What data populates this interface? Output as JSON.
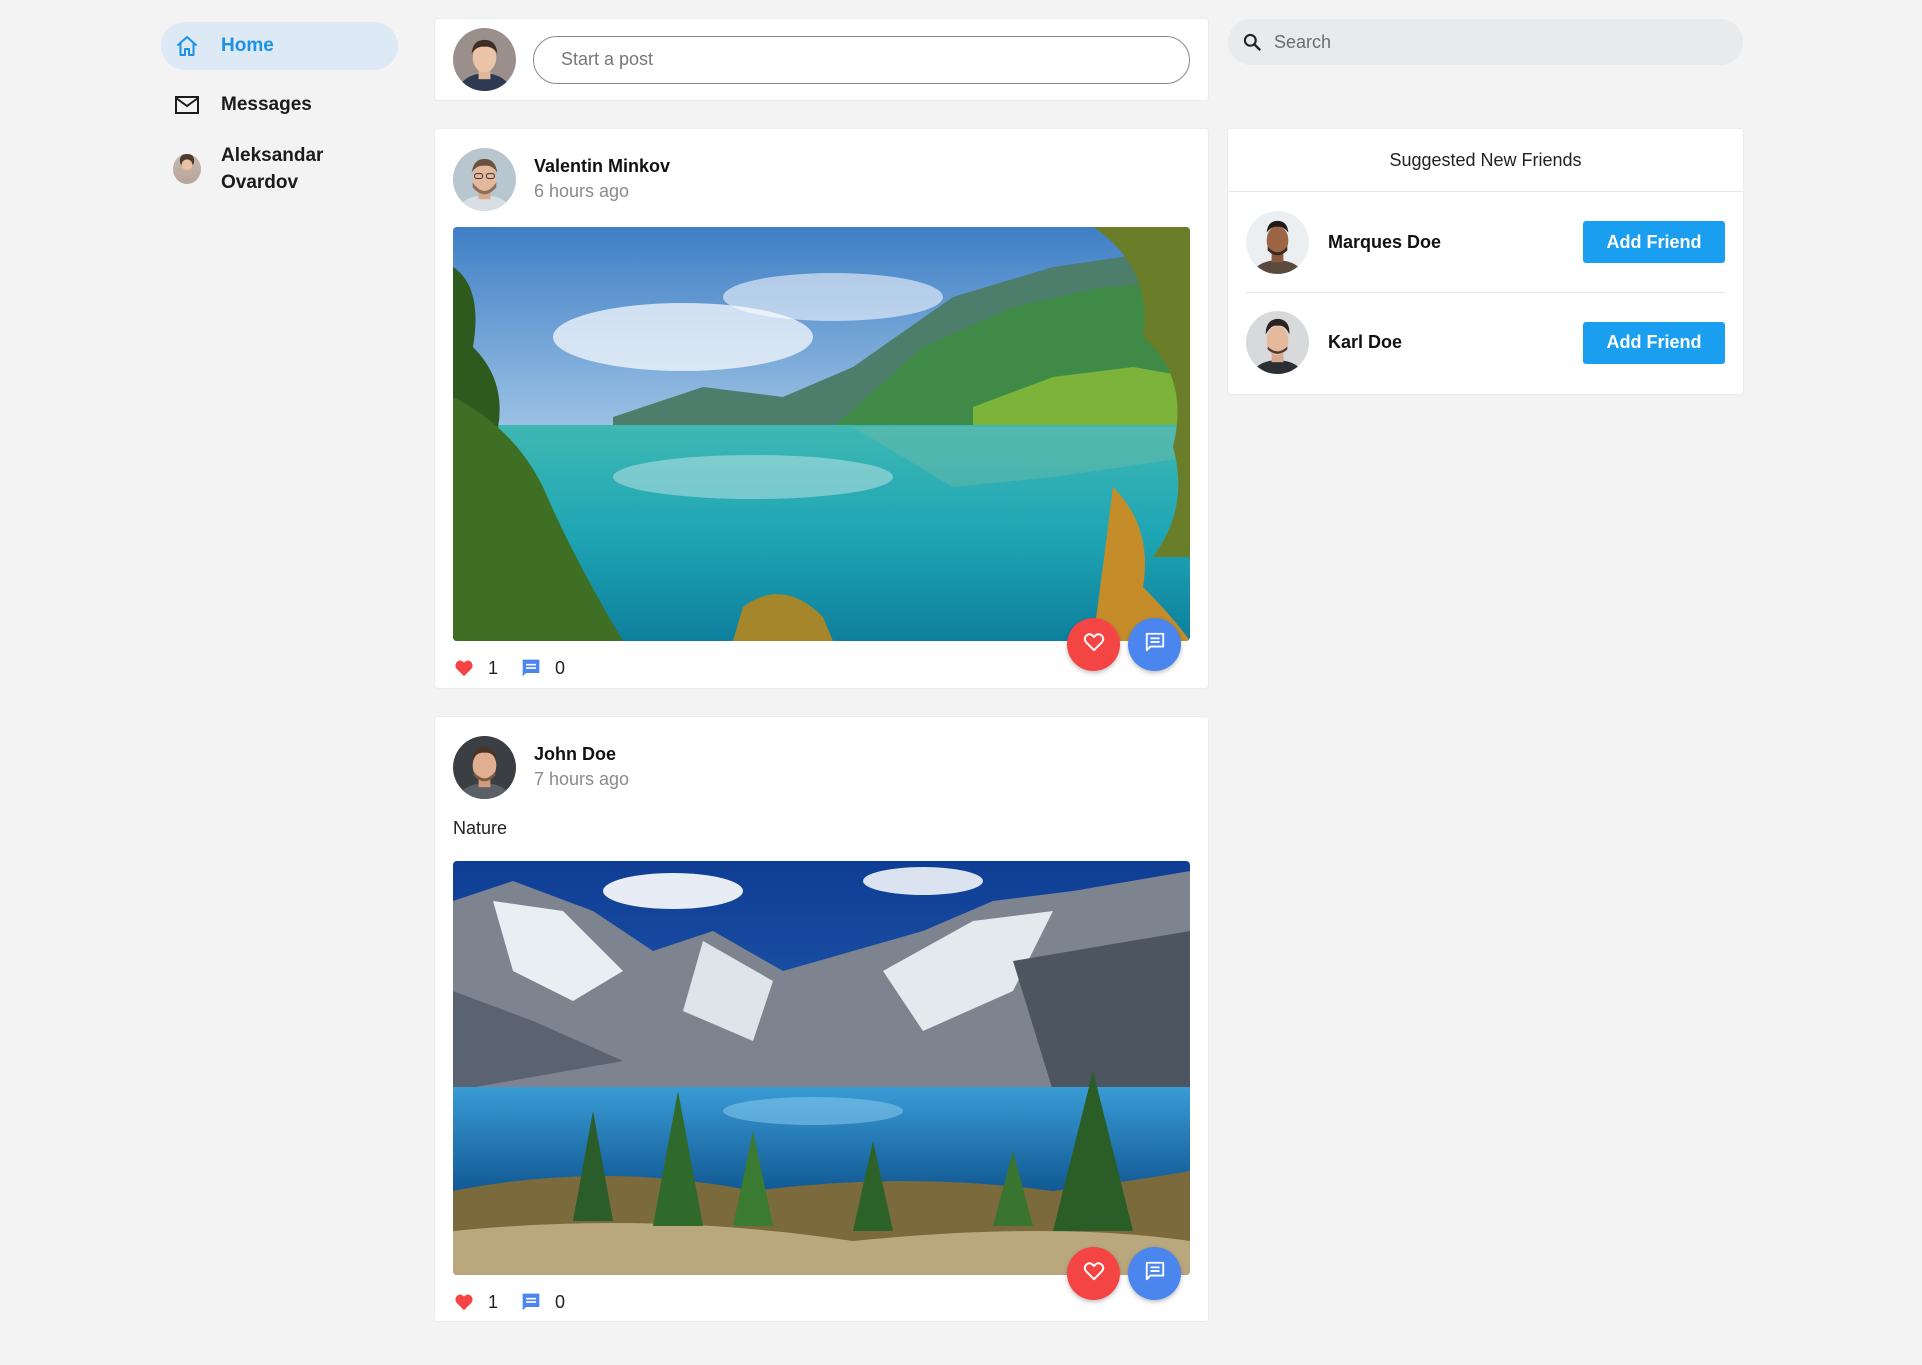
{
  "sidebar": {
    "items": [
      {
        "label": "Home",
        "icon": "home-icon",
        "active": true
      },
      {
        "label": "Messages",
        "icon": "mail-icon",
        "active": false
      },
      {
        "label": "Aleksandar Ovardov",
        "icon": "avatar",
        "active": false
      }
    ]
  },
  "composer": {
    "placeholder": "Start a post"
  },
  "search": {
    "placeholder": "Search"
  },
  "feed": {
    "posts": [
      {
        "author": "Valentin Minkov",
        "time": "6 hours ago",
        "text": "",
        "likes": "1",
        "comments": "0",
        "image": "lake-valley-image"
      },
      {
        "author": "John Doe",
        "time": "7 hours ago",
        "text": "Nature",
        "likes": "1",
        "comments": "0",
        "image": "mountain-lake-image"
      }
    ]
  },
  "suggestions": {
    "title": "Suggested New Friends",
    "friends": [
      {
        "name": "Marques Doe",
        "action": "Add Friend"
      },
      {
        "name": "Karl Doe",
        "action": "Add Friend"
      }
    ]
  },
  "colors": {
    "accent": "#1a93e6",
    "button": "#1a9ef0",
    "like": "#f44444",
    "comment": "#4b86ee",
    "background": "#f3f3f3"
  }
}
